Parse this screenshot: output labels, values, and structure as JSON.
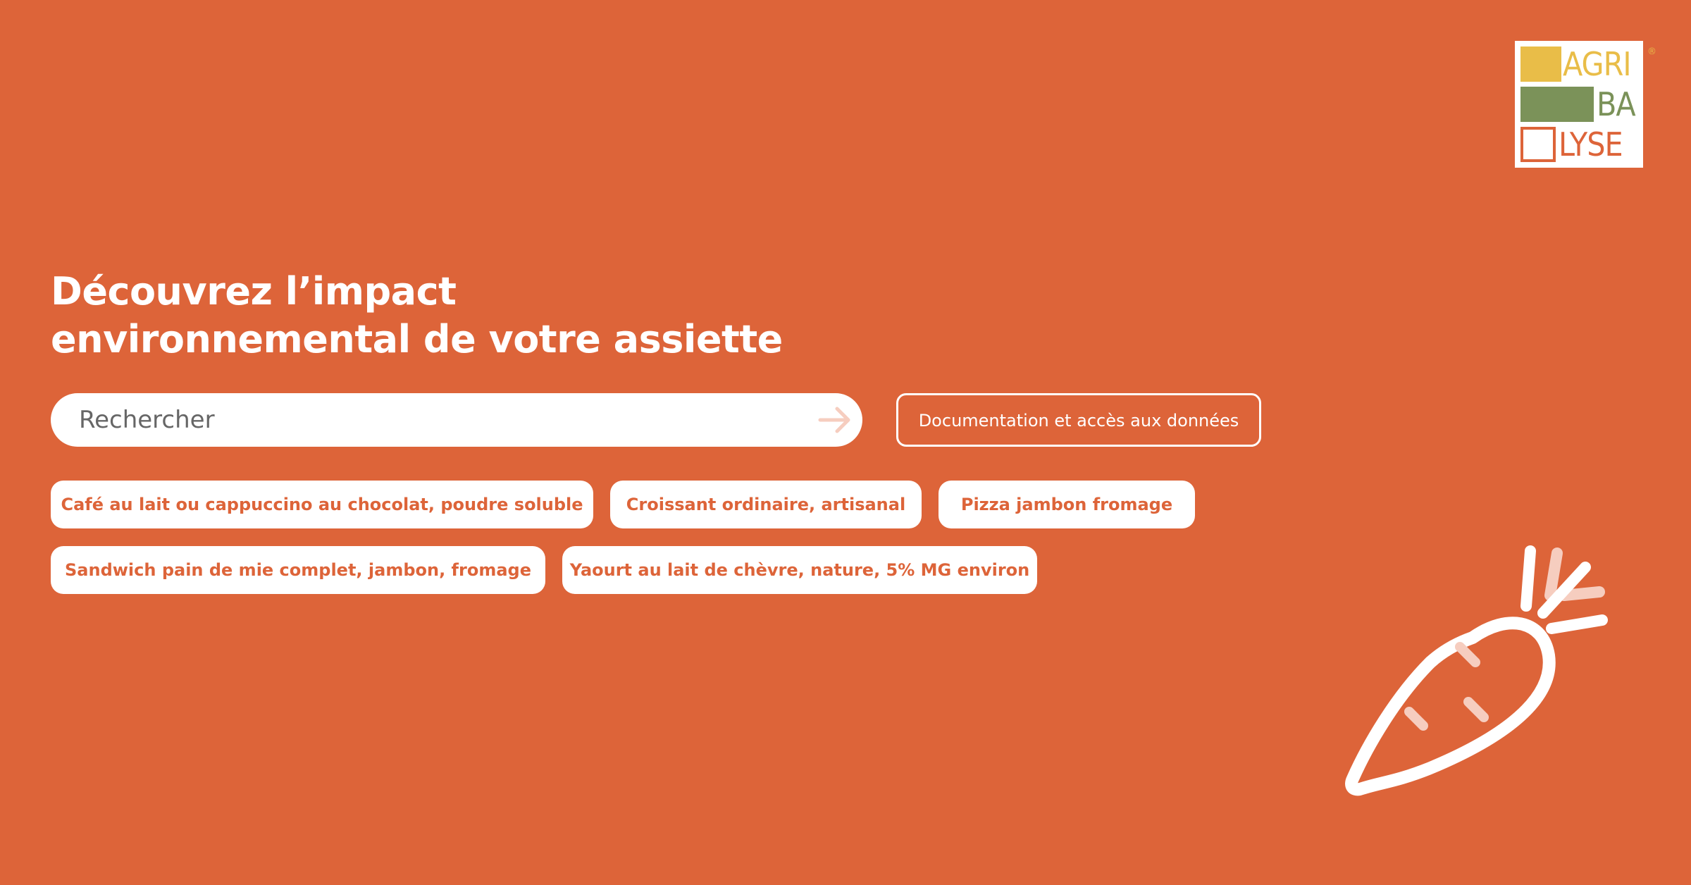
{
  "logo": {
    "line1": "AGRI",
    "line2": "BA",
    "line3": "LYSE",
    "registered": "®"
  },
  "hero": {
    "title_line1": "Découvrez l’impact",
    "title_line2": "environnemental de votre assiette"
  },
  "search": {
    "placeholder": "Rechercher",
    "submit_icon": "arrow-right-icon"
  },
  "documentation_button": "Documentation et accès aux données",
  "suggestions": [
    "Café au lait ou cappuccino au chocolat, poudre soluble",
    "Croissant ordinaire, artisanal",
    "Pizza jambon fromage",
    "Sandwich pain de mie complet, jambon, fromage",
    "Yaourt au lait de chèvre, nature, 5% MG environ"
  ],
  "colors": {
    "background": "#dd6439",
    "logo_yellow": "#e9bd48",
    "logo_green": "#7b9259",
    "text_white": "#ffffff",
    "accent_pink": "#f6cdbf"
  },
  "illustration": "carrot-icon"
}
